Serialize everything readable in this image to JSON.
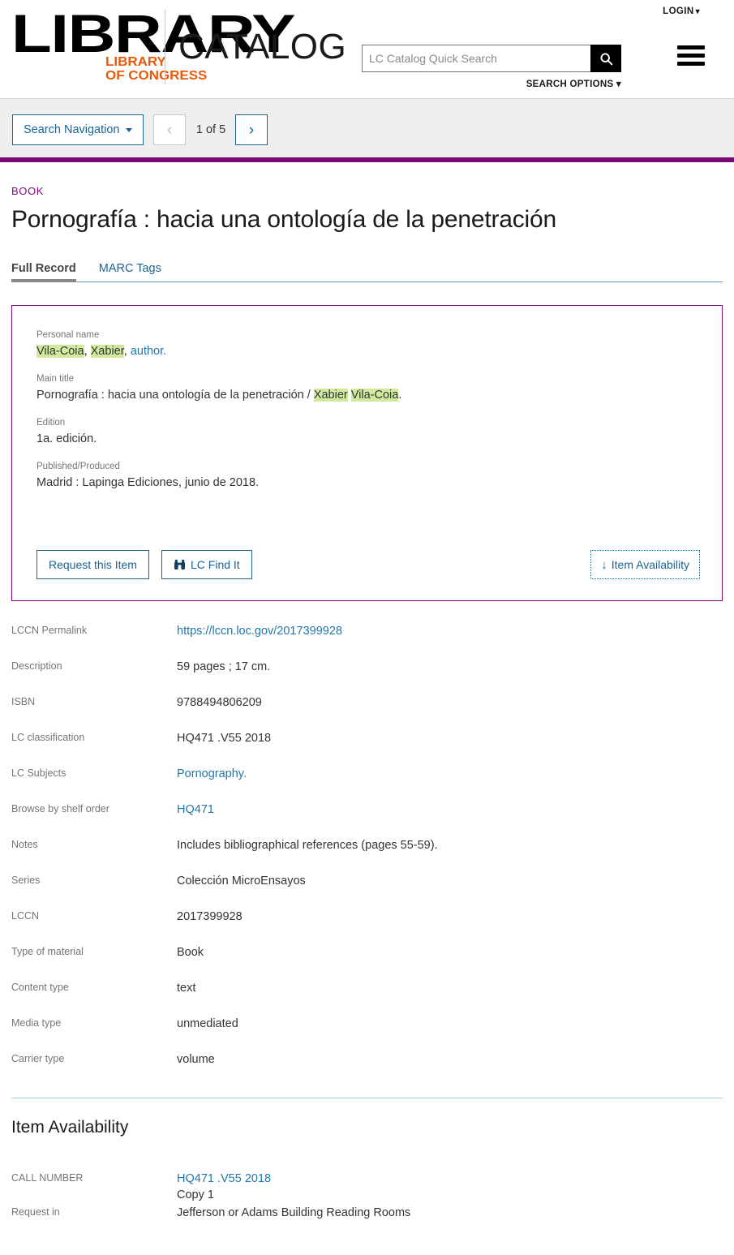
{
  "header": {
    "logo_main": "LIBRARY",
    "logo_sub_line1": "LIBRARY",
    "logo_sub_line2": "OF CONGRESS",
    "catalog_word": "CATALOG",
    "login_label": "LOGIN",
    "login_chevron": "⌄",
    "search_placeholder": "LC Catalog Quick Search",
    "search_value": "",
    "search_icon": "search-icon",
    "search_options_label": "SEARCH OPTIONS",
    "search_options_chevron": "⌄",
    "menu_icon": "hamburger-menu-icon"
  },
  "navbar": {
    "search_navigation_label": "Search Navigation",
    "prev_glyph": "‹",
    "next_glyph": "›",
    "page_counter": "1 of 5",
    "accent_color": "#7b0a78"
  },
  "record": {
    "kicker": "BOOK",
    "title": "Pornografía : hacia una ontología de la penetración",
    "tabs": [
      {
        "label": "Full Record",
        "active": true
      },
      {
        "label": "MARC Tags",
        "active": false
      }
    ],
    "highlight_color": "#d0eb9e",
    "fields": [
      {
        "label": "Personal name",
        "parts": [
          {
            "text": "Vila-Coia",
            "highlight": true
          },
          {
            "text": ", ",
            "highlight": false
          },
          {
            "text": "Xabier",
            "highlight": true
          },
          {
            "text": ", ",
            "highlight": false
          },
          {
            "text": "author.",
            "highlight": false,
            "link": true
          }
        ]
      },
      {
        "label": "Main title",
        "parts": [
          {
            "text": "Pornografía : hacia una ontología de la penetración / ",
            "highlight": false
          },
          {
            "text": "Xabier",
            "highlight": true
          },
          {
            "text": " ",
            "highlight": false
          },
          {
            "text": "Vila-Coia",
            "highlight": true
          },
          {
            "text": ".",
            "highlight": false
          }
        ]
      },
      {
        "label": "Edition",
        "parts": [
          {
            "text": "1a. edición.",
            "highlight": false
          }
        ]
      },
      {
        "label": "Published/Produced",
        "parts": [
          {
            "text": "Madrid : Lapinga Ediciones, junio de 2018.",
            "highlight": false
          }
        ]
      }
    ],
    "actions": {
      "request_label": "Request this Item",
      "findit_label": "LC Find It",
      "findit_icon": "binoculars-icon",
      "availability_label": "Item Availability",
      "availability_icon": "arrow-down-icon",
      "availability_arrow": "↓"
    }
  },
  "metadata": [
    {
      "label": "LCCN Permalink",
      "value": "https://lccn.loc.gov/2017399928",
      "link": true
    },
    {
      "label": "Description",
      "value": "59 pages ; 17 cm.",
      "link": false
    },
    {
      "label": "ISBN",
      "value": "9788494806209",
      "link": false
    },
    {
      "label": "LC classification",
      "value": "HQ471 .V55 2018",
      "link": false
    },
    {
      "label": "LC Subjects",
      "value": "Pornography.",
      "link": true
    },
    {
      "label": "Browse by shelf order",
      "value": "HQ471",
      "link": true
    },
    {
      "label": "Notes",
      "value": "Includes bibliographical references (pages 55-59).",
      "link": false
    },
    {
      "label": "Series",
      "value": "Colección MicroEnsayos",
      "link": false
    },
    {
      "label": "LCCN",
      "value": "2017399928",
      "link": false
    },
    {
      "label": "Type of material",
      "value": "Book",
      "link": false
    },
    {
      "label": "Content type",
      "value": "text",
      "link": false
    },
    {
      "label": "Media type",
      "value": "unmediated",
      "link": false
    },
    {
      "label": "Carrier type",
      "value": "volume",
      "link": false
    }
  ],
  "availability": {
    "section_title": "Item Availability",
    "rows": [
      {
        "label": "CALL NUMBER",
        "value": "HQ471 .V55 2018",
        "value2": "Copy 1",
        "link": true
      },
      {
        "label": "Request in",
        "value": "Jefferson or Adams Building Reading Rooms",
        "link": false
      }
    ]
  }
}
